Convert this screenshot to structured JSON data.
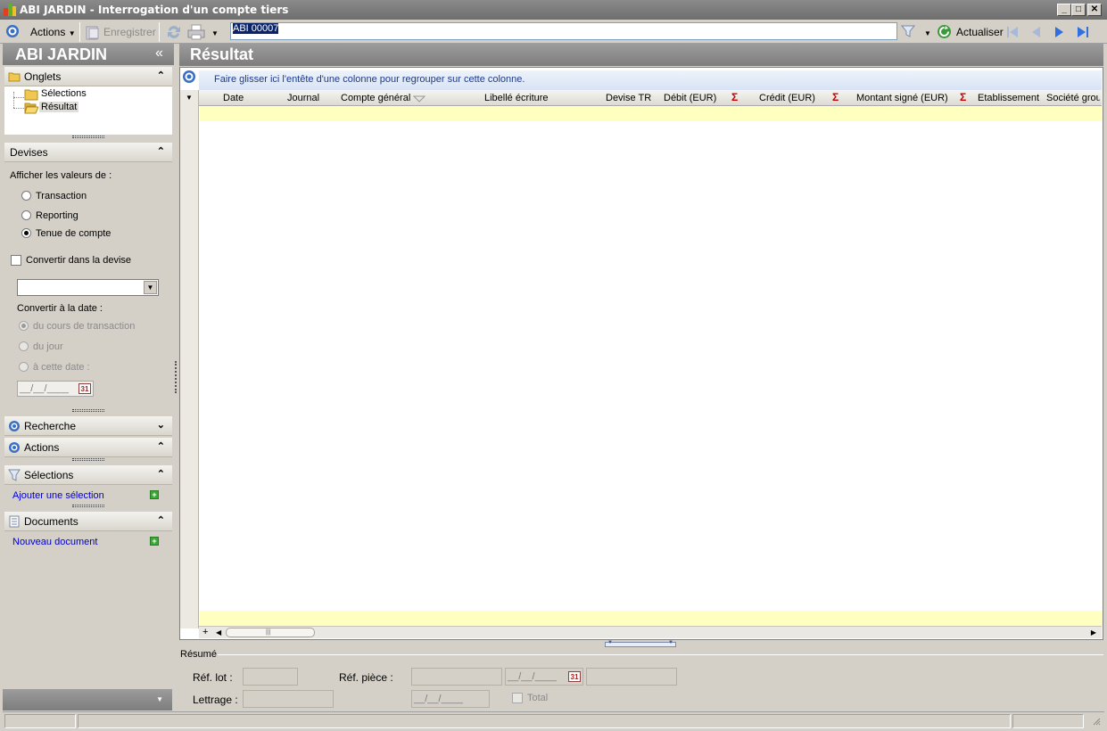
{
  "window": {
    "title": "ABI JARDIN -  Interrogation d'un compte tiers",
    "minimize": "_",
    "maximize": "□",
    "close": "✕"
  },
  "toolbar": {
    "actions_label": "Actions",
    "save_label": "Enregistrer",
    "search_value": "ABI 00007",
    "refresh_label": "Actualiser"
  },
  "left": {
    "company": "ABI JARDIN",
    "collapse_glyph": "«",
    "tabs_section": {
      "title": "Onglets",
      "items": [
        "Sélections",
        "Résultat"
      ]
    },
    "devises": {
      "title": "Devises",
      "show_values_label": "Afficher les valeurs de :",
      "radios": [
        "Transaction",
        "Reporting",
        "Tenue de compte"
      ],
      "convert_label": "Convertir dans la devise",
      "convert_date_label": "Convertir à la date :",
      "date_radios": [
        "du cours de transaction",
        "du jour",
        "à cette date :"
      ],
      "date_placeholder": "__/__/____",
      "cal_day": "31"
    },
    "recherche_title": "Recherche",
    "actions_title": "Actions",
    "selections": {
      "title": "Sélections",
      "link": "Ajouter une sélection"
    },
    "documents": {
      "title": "Documents",
      "link": "Nouveau document"
    }
  },
  "main": {
    "title": "Résultat",
    "group_hint": "Faire glisser ici l'entête d'une colonne pour regrouper sur cette colonne.",
    "columns": [
      "Date",
      "Journal",
      "Compte général",
      "Libellé écriture",
      "Devise TR",
      "Débit (EUR)",
      "Crédit (EUR)",
      "Montant signé (EUR)",
      "Etablissement",
      "Société grou"
    ],
    "sum_symbol": "Σ",
    "add_row": "+"
  },
  "summary": {
    "title": "Résumé",
    "ref_lot_label": "Réf. lot :",
    "ref_piece_label": "Réf. pièce :",
    "lettrage_label": "Lettrage :",
    "date_placeholder": "__/__/____",
    "cal_day": "31",
    "total_label": "Total"
  },
  "colors": {
    "header_gray": "#8a8a8a",
    "grid_yellow": "#ffffc0",
    "link_blue": "#0000cc",
    "sum_red": "#c00000"
  }
}
